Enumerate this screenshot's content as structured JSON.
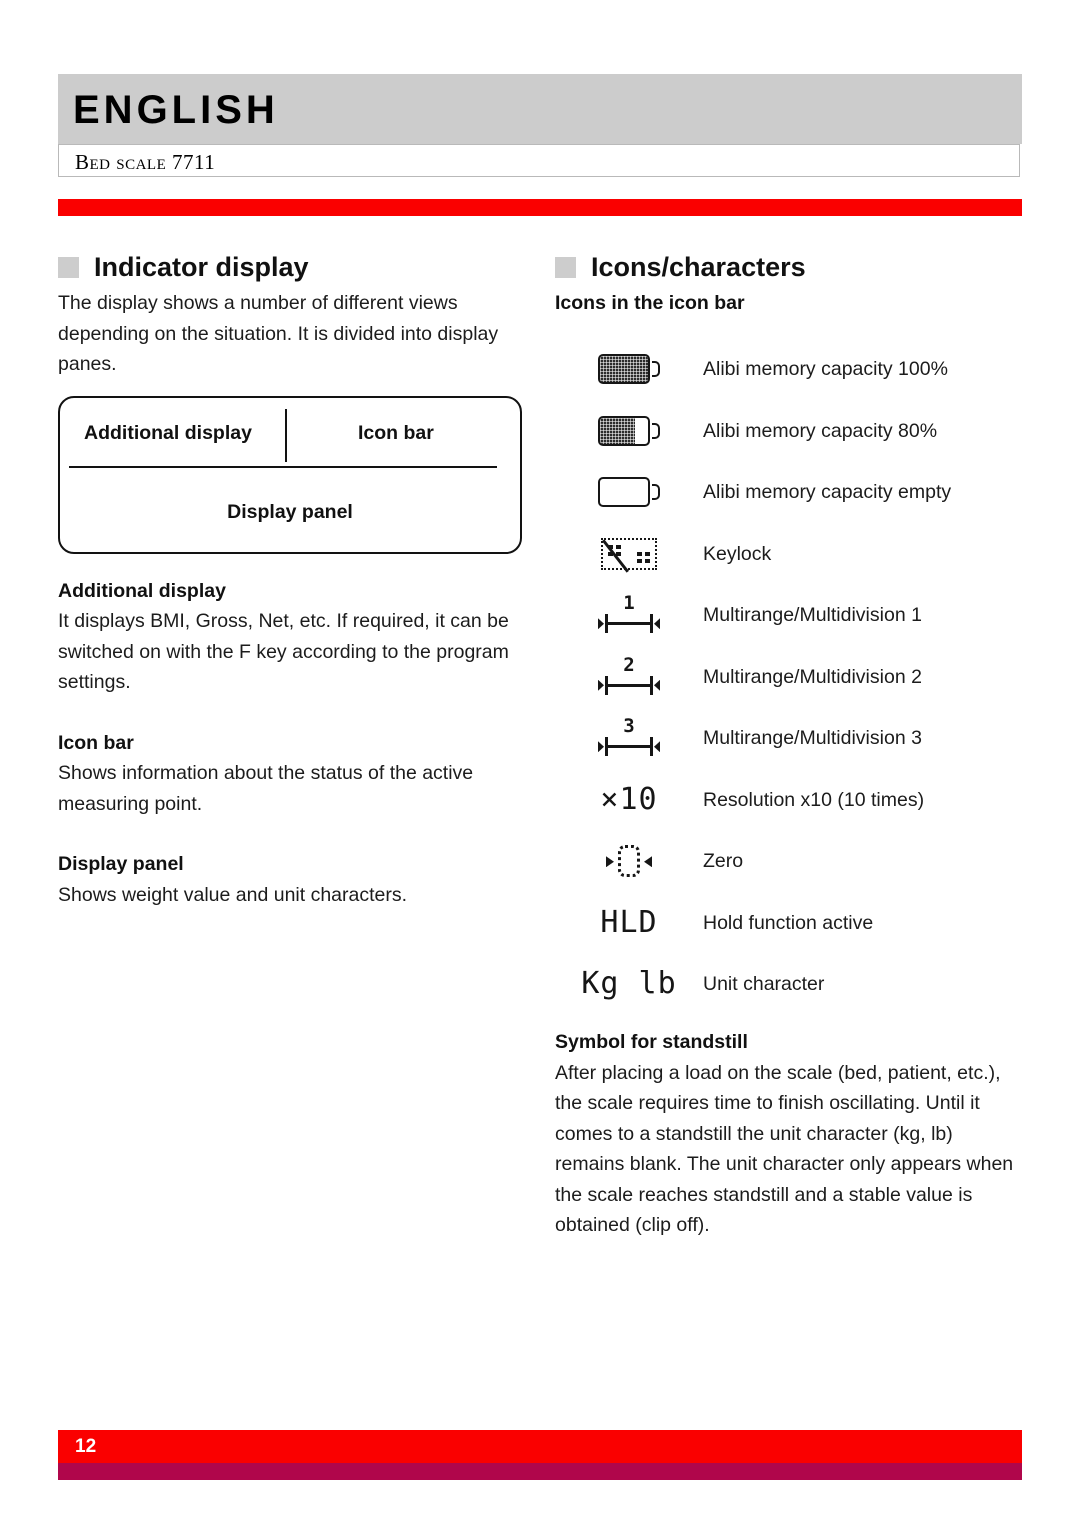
{
  "header": {
    "title": "ENGLISH",
    "subtitle": "Bed scale 7711",
    "accent_color": "#fa0000",
    "band_color": "#cccccc"
  },
  "left_column": {
    "section_title": "Indicator display",
    "intro_paragraph": "The display shows a number of different views depending on the situation. It is divided into display panes.",
    "diagram": {
      "additional_display_label": "Additional display",
      "icon_bar_label": "Icon bar",
      "display_panel_label": "Display panel"
    },
    "blocks": [
      {
        "heading": "Additional display",
        "text": "It displays BMI, Gross, Net, etc. If required, it can be switched on with the F key according to the program settings."
      },
      {
        "heading": "Icon bar",
        "text": "Shows information about the status of the active measuring point."
      },
      {
        "heading": "Display panel",
        "text": "Shows weight value and unit characters."
      }
    ]
  },
  "right_column": {
    "section_title": "Icons/characters",
    "icon_bar_heading": "Icons in the icon bar",
    "icons": [
      {
        "icon_name": "battery-full-icon",
        "glyph": "",
        "label": "Alibi memory capacity 100%"
      },
      {
        "icon_name": "battery-80-icon",
        "glyph": "",
        "label": "Alibi memory capacity 80%"
      },
      {
        "icon_name": "battery-empty-icon",
        "glyph": "",
        "label": "Alibi memory capacity empty"
      },
      {
        "icon_name": "keylock-icon",
        "glyph": "",
        "label": "Keylock"
      },
      {
        "icon_name": "multirange-1-icon",
        "glyph": "1",
        "label": "Multirange/Multidivision 1"
      },
      {
        "icon_name": "multirange-2-icon",
        "glyph": "2",
        "label": "Multirange/Multidivision 2"
      },
      {
        "icon_name": "multirange-3-icon",
        "glyph": "3",
        "label": "Multirange/Multidivision 3"
      },
      {
        "icon_name": "resolution-x10-icon",
        "glyph": "×10",
        "label": "Resolution x10 (10 times)"
      },
      {
        "icon_name": "zero-icon",
        "glyph": "",
        "label": "Zero"
      },
      {
        "icon_name": "hold-icon",
        "glyph": "HLD",
        "label": "Hold function active"
      },
      {
        "icon_name": "unit-character-icon",
        "glyph": "Kg lb",
        "label": "Unit character"
      }
    ],
    "standstill": {
      "heading": "Symbol for standstill",
      "text": "After placing a load on the scale (bed, patient, etc.), the scale requires time to finish oscillating. Until it comes to a standstill the unit character (kg, lb) remains blank. The unit character only appears when the scale reaches standstill and a stable value is obtained (clip off)."
    }
  },
  "footer": {
    "page_number": "12",
    "bar_color": "#fa0000",
    "accent_color": "#b0064b"
  }
}
